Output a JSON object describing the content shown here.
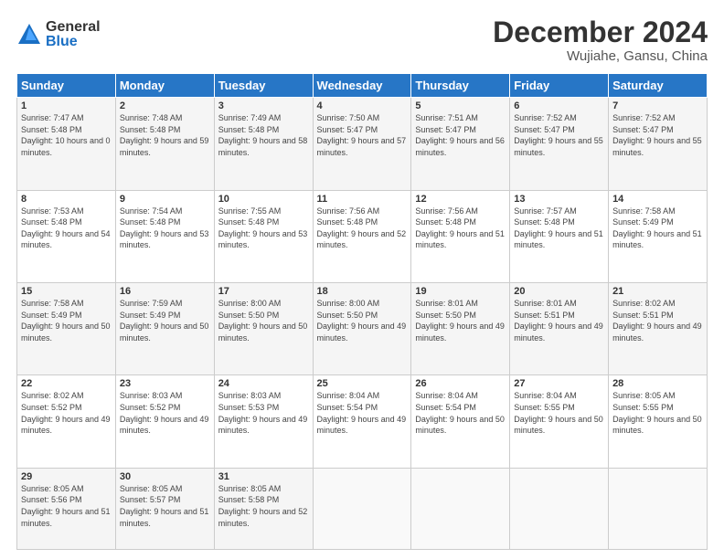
{
  "logo": {
    "general": "General",
    "blue": "Blue"
  },
  "header": {
    "title": "December 2024",
    "subtitle": "Wujiahe, Gansu, China"
  },
  "days_of_week": [
    "Sunday",
    "Monday",
    "Tuesday",
    "Wednesday",
    "Thursday",
    "Friday",
    "Saturday"
  ],
  "weeks": [
    [
      {
        "day": "1",
        "sunrise": "7:47 AM",
        "sunset": "5:48 PM",
        "daylight": "10 hours and 0 minutes."
      },
      {
        "day": "2",
        "sunrise": "7:48 AM",
        "sunset": "5:48 PM",
        "daylight": "9 hours and 59 minutes."
      },
      {
        "day": "3",
        "sunrise": "7:49 AM",
        "sunset": "5:48 PM",
        "daylight": "9 hours and 58 minutes."
      },
      {
        "day": "4",
        "sunrise": "7:50 AM",
        "sunset": "5:47 PM",
        "daylight": "9 hours and 57 minutes."
      },
      {
        "day": "5",
        "sunrise": "7:51 AM",
        "sunset": "5:47 PM",
        "daylight": "9 hours and 56 minutes."
      },
      {
        "day": "6",
        "sunrise": "7:52 AM",
        "sunset": "5:47 PM",
        "daylight": "9 hours and 55 minutes."
      },
      {
        "day": "7",
        "sunrise": "7:52 AM",
        "sunset": "5:47 PM",
        "daylight": "9 hours and 55 minutes."
      }
    ],
    [
      {
        "day": "8",
        "sunrise": "7:53 AM",
        "sunset": "5:48 PM",
        "daylight": "9 hours and 54 minutes."
      },
      {
        "day": "9",
        "sunrise": "7:54 AM",
        "sunset": "5:48 PM",
        "daylight": "9 hours and 53 minutes."
      },
      {
        "day": "10",
        "sunrise": "7:55 AM",
        "sunset": "5:48 PM",
        "daylight": "9 hours and 53 minutes."
      },
      {
        "day": "11",
        "sunrise": "7:56 AM",
        "sunset": "5:48 PM",
        "daylight": "9 hours and 52 minutes."
      },
      {
        "day": "12",
        "sunrise": "7:56 AM",
        "sunset": "5:48 PM",
        "daylight": "9 hours and 51 minutes."
      },
      {
        "day": "13",
        "sunrise": "7:57 AM",
        "sunset": "5:48 PM",
        "daylight": "9 hours and 51 minutes."
      },
      {
        "day": "14",
        "sunrise": "7:58 AM",
        "sunset": "5:49 PM",
        "daylight": "9 hours and 51 minutes."
      }
    ],
    [
      {
        "day": "15",
        "sunrise": "7:58 AM",
        "sunset": "5:49 PM",
        "daylight": "9 hours and 50 minutes."
      },
      {
        "day": "16",
        "sunrise": "7:59 AM",
        "sunset": "5:49 PM",
        "daylight": "9 hours and 50 minutes."
      },
      {
        "day": "17",
        "sunrise": "8:00 AM",
        "sunset": "5:50 PM",
        "daylight": "9 hours and 50 minutes."
      },
      {
        "day": "18",
        "sunrise": "8:00 AM",
        "sunset": "5:50 PM",
        "daylight": "9 hours and 49 minutes."
      },
      {
        "day": "19",
        "sunrise": "8:01 AM",
        "sunset": "5:50 PM",
        "daylight": "9 hours and 49 minutes."
      },
      {
        "day": "20",
        "sunrise": "8:01 AM",
        "sunset": "5:51 PM",
        "daylight": "9 hours and 49 minutes."
      },
      {
        "day": "21",
        "sunrise": "8:02 AM",
        "sunset": "5:51 PM",
        "daylight": "9 hours and 49 minutes."
      }
    ],
    [
      {
        "day": "22",
        "sunrise": "8:02 AM",
        "sunset": "5:52 PM",
        "daylight": "9 hours and 49 minutes."
      },
      {
        "day": "23",
        "sunrise": "8:03 AM",
        "sunset": "5:52 PM",
        "daylight": "9 hours and 49 minutes."
      },
      {
        "day": "24",
        "sunrise": "8:03 AM",
        "sunset": "5:53 PM",
        "daylight": "9 hours and 49 minutes."
      },
      {
        "day": "25",
        "sunrise": "8:04 AM",
        "sunset": "5:54 PM",
        "daylight": "9 hours and 49 minutes."
      },
      {
        "day": "26",
        "sunrise": "8:04 AM",
        "sunset": "5:54 PM",
        "daylight": "9 hours and 50 minutes."
      },
      {
        "day": "27",
        "sunrise": "8:04 AM",
        "sunset": "5:55 PM",
        "daylight": "9 hours and 50 minutes."
      },
      {
        "day": "28",
        "sunrise": "8:05 AM",
        "sunset": "5:55 PM",
        "daylight": "9 hours and 50 minutes."
      }
    ],
    [
      {
        "day": "29",
        "sunrise": "8:05 AM",
        "sunset": "5:56 PM",
        "daylight": "9 hours and 51 minutes."
      },
      {
        "day": "30",
        "sunrise": "8:05 AM",
        "sunset": "5:57 PM",
        "daylight": "9 hours and 51 minutes."
      },
      {
        "day": "31",
        "sunrise": "8:05 AM",
        "sunset": "5:58 PM",
        "daylight": "9 hours and 52 minutes."
      },
      null,
      null,
      null,
      null
    ]
  ],
  "labels": {
    "sunrise": "Sunrise:",
    "sunset": "Sunset:",
    "daylight": "Daylight:"
  }
}
